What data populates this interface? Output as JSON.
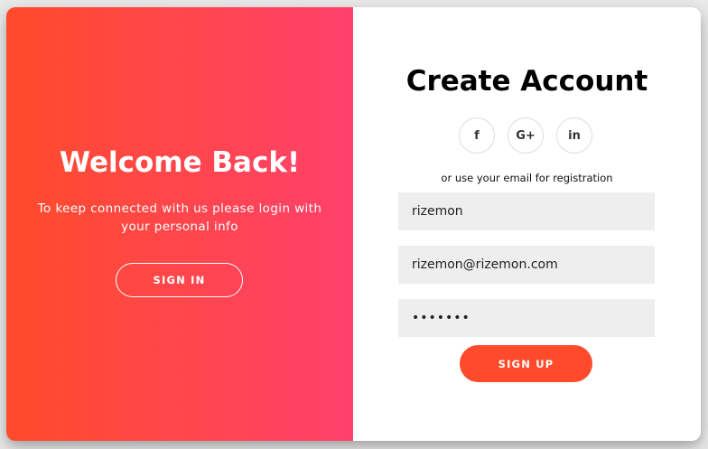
{
  "colors": {
    "accent": "#ff4b2b",
    "accent_gradient_end": "#ff416c",
    "field_background": "#eeeeee"
  },
  "overlay": {
    "title": "Welcome Back!",
    "text": "To keep connected with us please login with your personal info",
    "sign_in_label": "Sign In"
  },
  "signup": {
    "title": "Create Account",
    "socials": [
      {
        "icon": "facebook-icon",
        "glyph": "f"
      },
      {
        "icon": "google-plus-icon",
        "glyph": "G+"
      },
      {
        "icon": "linkedin-icon",
        "glyph": "in"
      }
    ],
    "hint": "or use your email for registration",
    "name_value": "rizemon",
    "email_value": "rizemon@rizemon.com",
    "password_value": "rizemon",
    "sign_up_label": "Sign Up"
  }
}
